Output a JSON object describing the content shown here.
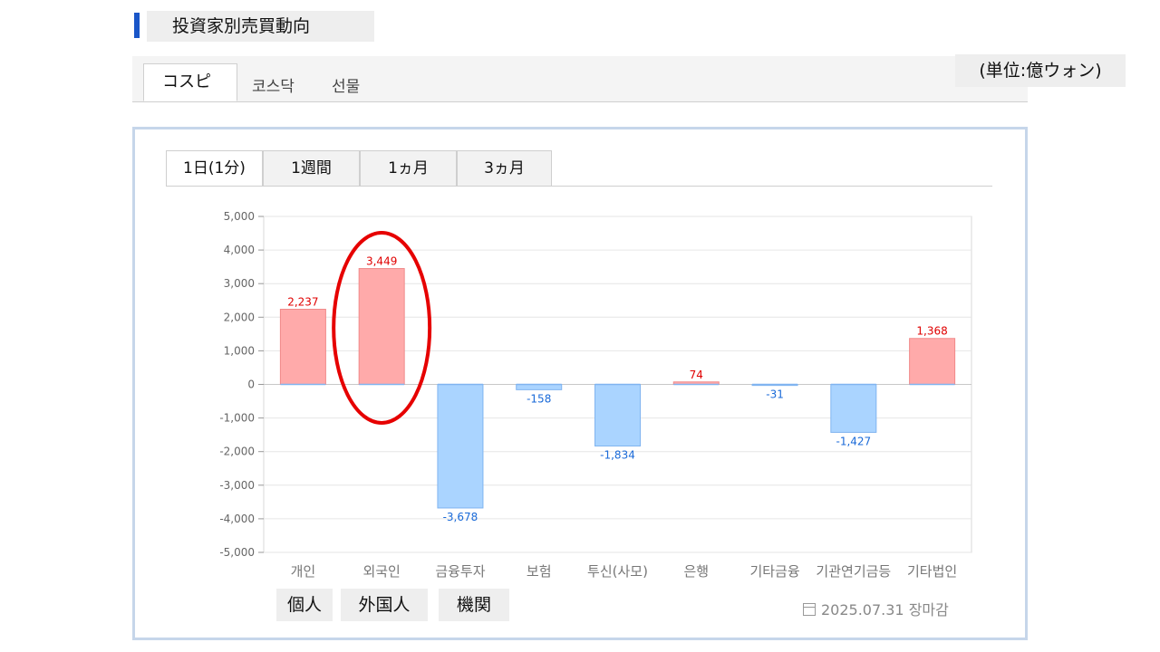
{
  "header": {
    "title": "投資家別売買動向",
    "unit": "(単位:億ウォン)"
  },
  "market_tabs": [
    {
      "label": "コスピ",
      "active": true
    },
    {
      "label": "코스닥",
      "active": false
    },
    {
      "label": "선물",
      "active": false
    }
  ],
  "period_tabs": [
    {
      "label": "1日(1分)",
      "active": true
    },
    {
      "label": "1週間",
      "active": false
    },
    {
      "label": "1ヵ月",
      "active": false
    },
    {
      "label": "3ヵ月",
      "active": false
    }
  ],
  "group_labels": [
    "個人",
    "外国人",
    "機関"
  ],
  "footer": {
    "date": "2025.07.31 장마감",
    "icon": "calendar-icon"
  },
  "colors": {
    "positive_fill": "#ffaaaa",
    "positive_stroke": "#f08a8a",
    "positive_text": "#e00000",
    "negative_fill": "#aad4ff",
    "negative_stroke": "#80b4f0",
    "negative_text": "#1a6ad8",
    "highlight": "#e60000",
    "accent": "#1a56c8"
  },
  "chart_data": {
    "type": "bar",
    "categories": [
      "개인",
      "외국인",
      "금융투자",
      "보험",
      "투신(사모)",
      "은행",
      "기타금융",
      "기관연기금등",
      "기타법인"
    ],
    "values": [
      2237,
      3449,
      -3678,
      -158,
      -1834,
      74,
      -31,
      -1427,
      1368
    ],
    "value_labels": [
      "2,237",
      "3,449",
      "-3,678",
      "-158",
      "-1,834",
      "74",
      "-31",
      "-1,427",
      "1,368"
    ],
    "ylim": [
      -5000,
      5000
    ],
    "yticks": [
      5000,
      4000,
      3000,
      2000,
      1000,
      0,
      -1000,
      -2000,
      -3000,
      -4000,
      -5000
    ],
    "ytick_labels": [
      "5,000",
      "4,000",
      "3,000",
      "2,000",
      "1,000",
      "0",
      "-1,000",
      "-2,000",
      "-3,000",
      "-4,000",
      "-5,000"
    ],
    "grid": true,
    "highlighted_category": "외국인"
  }
}
